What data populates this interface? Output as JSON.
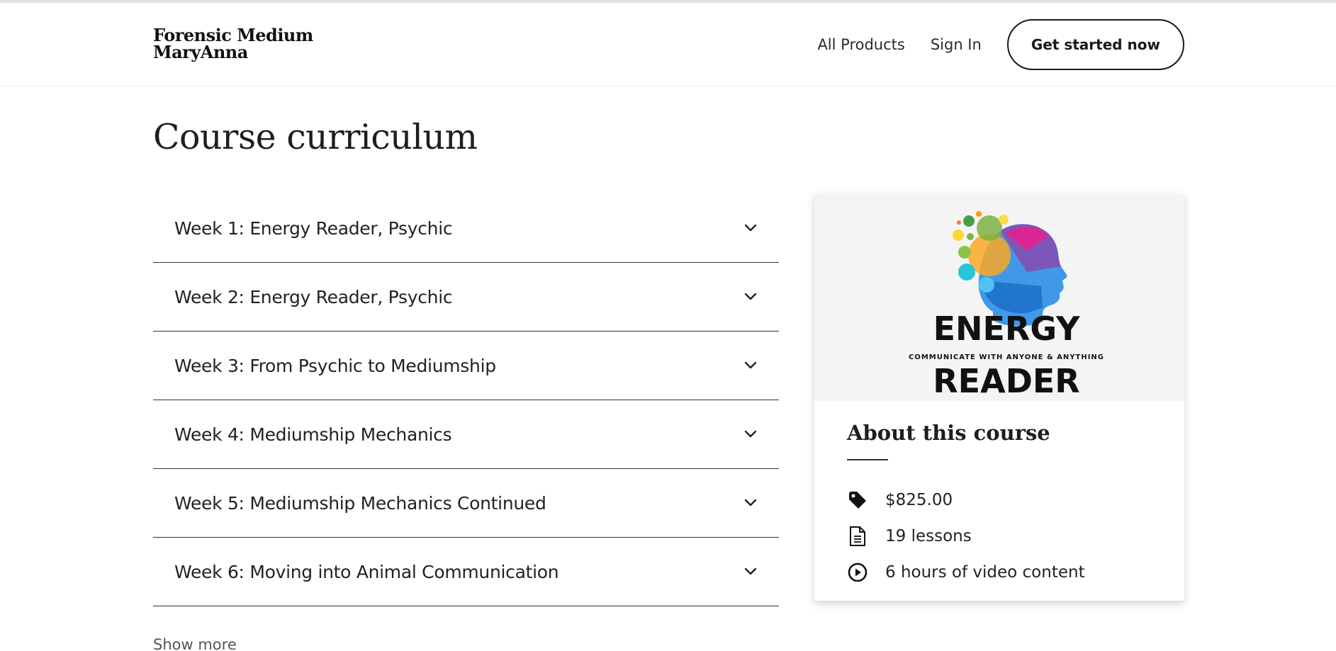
{
  "header": {
    "logo_line1": "Forensic Medium",
    "logo_line2": "MaryAnna",
    "nav": {
      "all_products": "All Products",
      "sign_in": "Sign In",
      "cta": "Get started now"
    }
  },
  "curriculum": {
    "title": "Course curriculum",
    "weeks": [
      {
        "label": "Week 1: Energy Reader, Psychic"
      },
      {
        "label": "Week 2: Energy Reader, Psychic"
      },
      {
        "label": "Week 3: From Psychic to Mediumship"
      },
      {
        "label": "Week 4: Mediumship Mechanics"
      },
      {
        "label": "Week 5: Mediumship Mechanics Continued"
      },
      {
        "label": "Week 6: Moving into Animal Communication"
      }
    ],
    "show_more": "Show more"
  },
  "course_card": {
    "logo_word1": "ENERGY",
    "logo_tagline": "COMMUNICATE WITH ANYONE & ANYTHING",
    "logo_word2": "READER",
    "title": "About this course",
    "price": "$825.00",
    "lessons": "19 lessons",
    "video": "6 hours of video content",
    "icons": {
      "price": "price-tag-icon",
      "lessons": "document-icon",
      "video": "play-circle-icon"
    }
  }
}
